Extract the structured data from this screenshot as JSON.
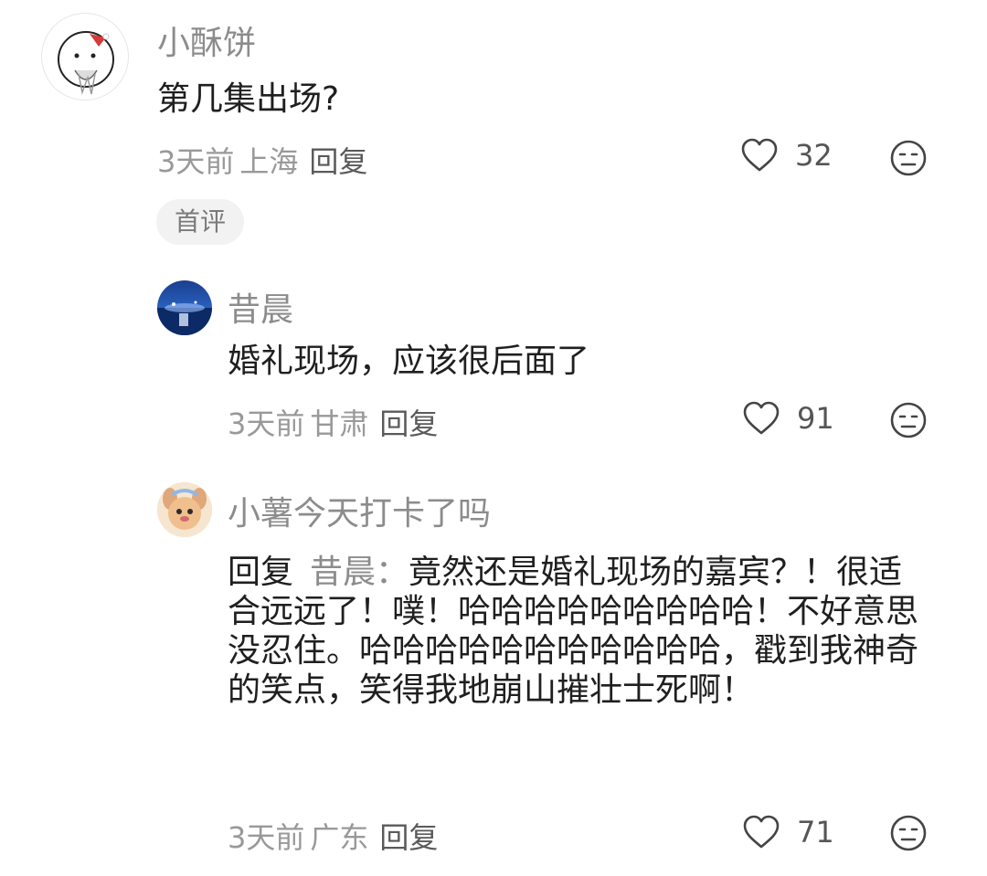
{
  "comments": [
    {
      "username": "小酥饼",
      "text": "第几集出场?",
      "time": "3天前",
      "region": "上海",
      "reply_label": "回复",
      "likes": "32",
      "badge": "首评"
    },
    {
      "username": "昔晨",
      "text": "婚礼现场，应该很后面了",
      "time": "3天前",
      "region": "甘肃",
      "reply_label": "回复",
      "likes": "91"
    },
    {
      "username": "小薯今天打卡了吗",
      "reply_prefix": "回复",
      "reply_target": "昔晨：",
      "text": "竟然还是婚礼现场的嘉宾？！很适合远远了！噗！哈哈哈哈哈哈哈哈哈！不好意思没忍住。哈哈哈哈哈哈哈哈哈哈哈，戳到我神奇的笑点，笑得我地崩山摧壮士死啊！",
      "time": "3天前",
      "region": "广东",
      "reply_label": "回复",
      "likes": "71"
    }
  ],
  "icons": {
    "like": "heart-outline-icon",
    "dislike": "meh-face-icon"
  },
  "colors": {
    "username": "#8c8c8c",
    "meta": "#999999",
    "text": "#1f1f1f",
    "badge_bg": "#f2f2f2"
  }
}
